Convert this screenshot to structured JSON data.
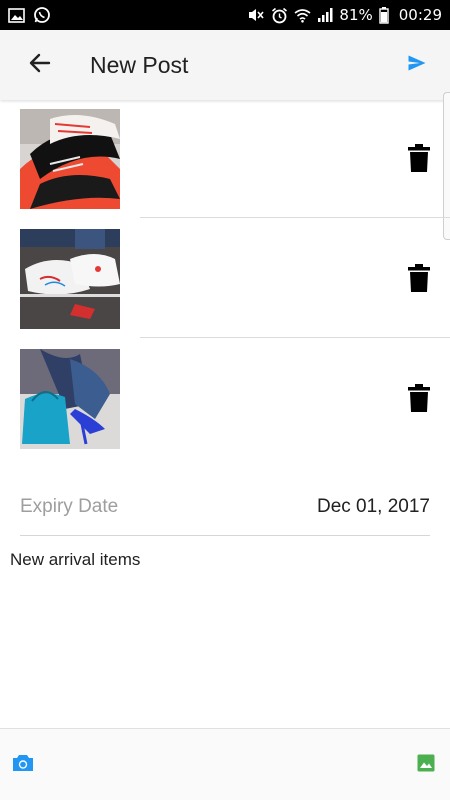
{
  "status_bar": {
    "left_icons": [
      "image-icon",
      "whatsapp-icon"
    ],
    "right_icons": [
      "mute-icon",
      "alarm-icon",
      "wifi-icon",
      "signal-icon"
    ],
    "battery": "81%",
    "time": "00:29"
  },
  "app_bar": {
    "back_icon": "arrow-left-icon",
    "title": "New Post",
    "send_icon": "send-icon"
  },
  "images": [
    {
      "name": "black-red-sneakers",
      "delete_icon": "trash-icon"
    },
    {
      "name": "white-embroidered-sneakers",
      "delete_icon": "trash-icon"
    },
    {
      "name": "blue-heels-with-bag",
      "delete_icon": "trash-icon"
    }
  ],
  "expiry": {
    "label": "Expiry Date",
    "value": "Dec 01, 2017"
  },
  "caption": "New arrival items",
  "bottom_bar": {
    "camera_icon": "camera-icon",
    "gallery_icon": "gallery-icon"
  },
  "colors": {
    "accent": "#2196f3",
    "gallery_green": "#4caf50",
    "app_bar_bg": "#f5f5f5",
    "status_bar_bg": "#000000"
  }
}
